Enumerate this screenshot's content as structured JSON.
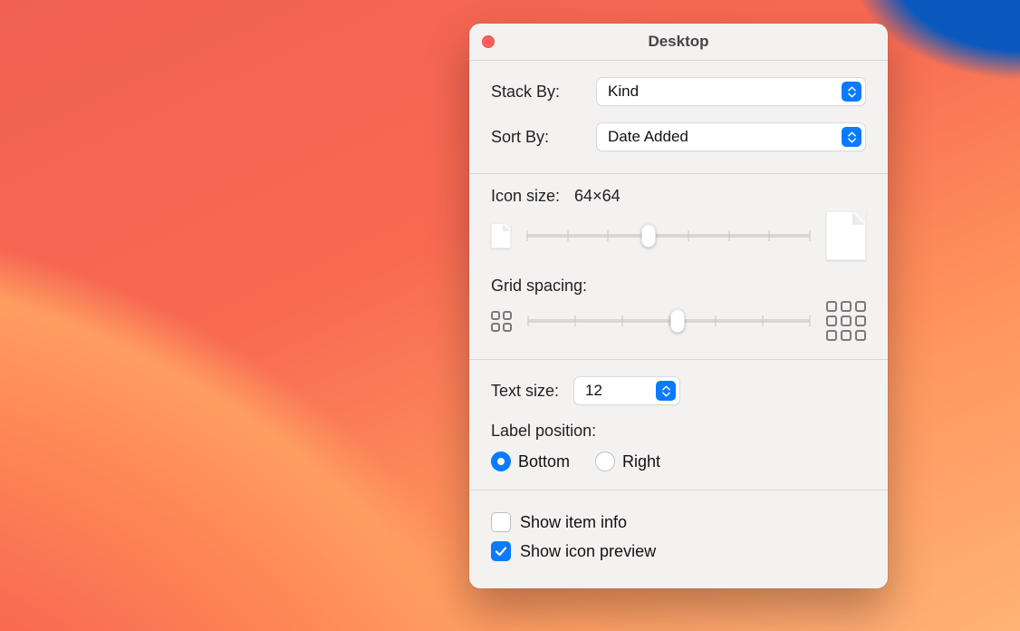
{
  "window": {
    "title": "Desktop"
  },
  "stack": {
    "label": "Stack By:",
    "value": "Kind"
  },
  "sort": {
    "label": "Sort By:",
    "value": "Date Added"
  },
  "iconSize": {
    "label": "Icon size:",
    "value": "64×64",
    "percent": 43
  },
  "gridSpacing": {
    "label": "Grid spacing:",
    "percent": 53
  },
  "textSize": {
    "label": "Text size:",
    "value": "12"
  },
  "labelPosition": {
    "label": "Label position:",
    "options": {
      "bottom": "Bottom",
      "right": "Right"
    },
    "selected": "bottom"
  },
  "showItemInfo": {
    "label": "Show item info",
    "checked": false
  },
  "showIconPreview": {
    "label": "Show icon preview",
    "checked": true
  }
}
